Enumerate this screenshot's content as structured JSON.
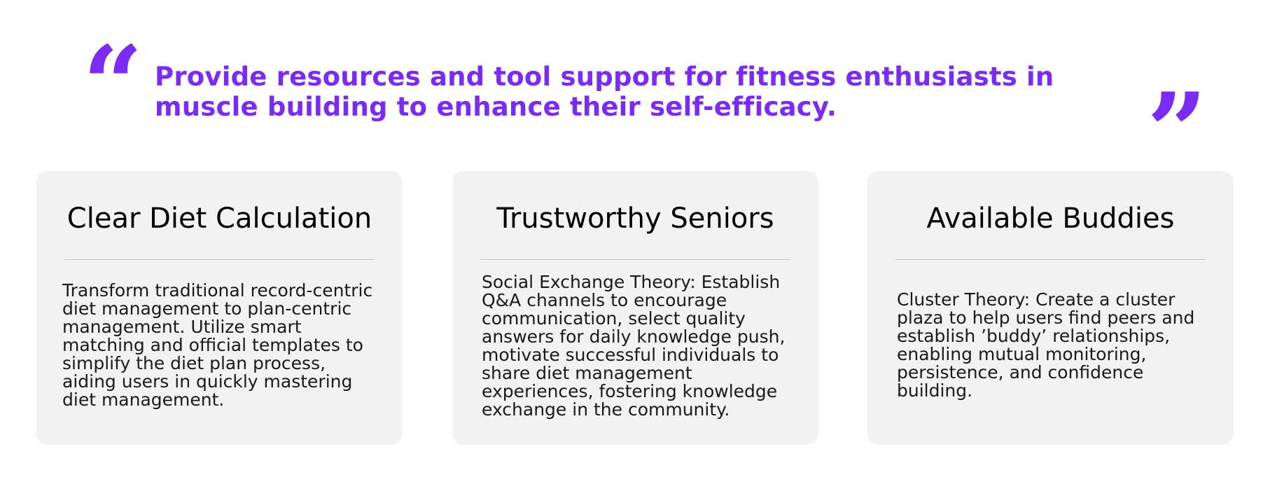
{
  "quote": {
    "open_mark": "“",
    "close_mark": "”",
    "text": "Provide resources and tool support for fitness enthusiasts in muscle building to enhance their self-efficacy."
  },
  "colors": {
    "accent": "#7a2bf5",
    "card_background": "#f2f2f2",
    "divider": "#c4c4c4"
  },
  "cards": [
    {
      "title": "Clear Diet Calculation",
      "body": "Transform traditional record-centric diet management to plan-centric management. Utilize smart matching and official templates to simplify the diet plan process, aiding users in quickly mastering diet management."
    },
    {
      "title": "Trustworthy Seniors",
      "body": "Social Exchange Theory: Establish Q&A channels to encourage communication, select quality answers for daily knowledge push, motivate successful individuals to share diet management experiences, fostering knowledge exchange in the community."
    },
    {
      "title": "Available Buddies",
      "body": "Cluster Theory: Create a cluster plaza to help users find peers and establish ’buddy’ relationships, enabling mutual monitoring, persistence, and confidence building."
    }
  ]
}
